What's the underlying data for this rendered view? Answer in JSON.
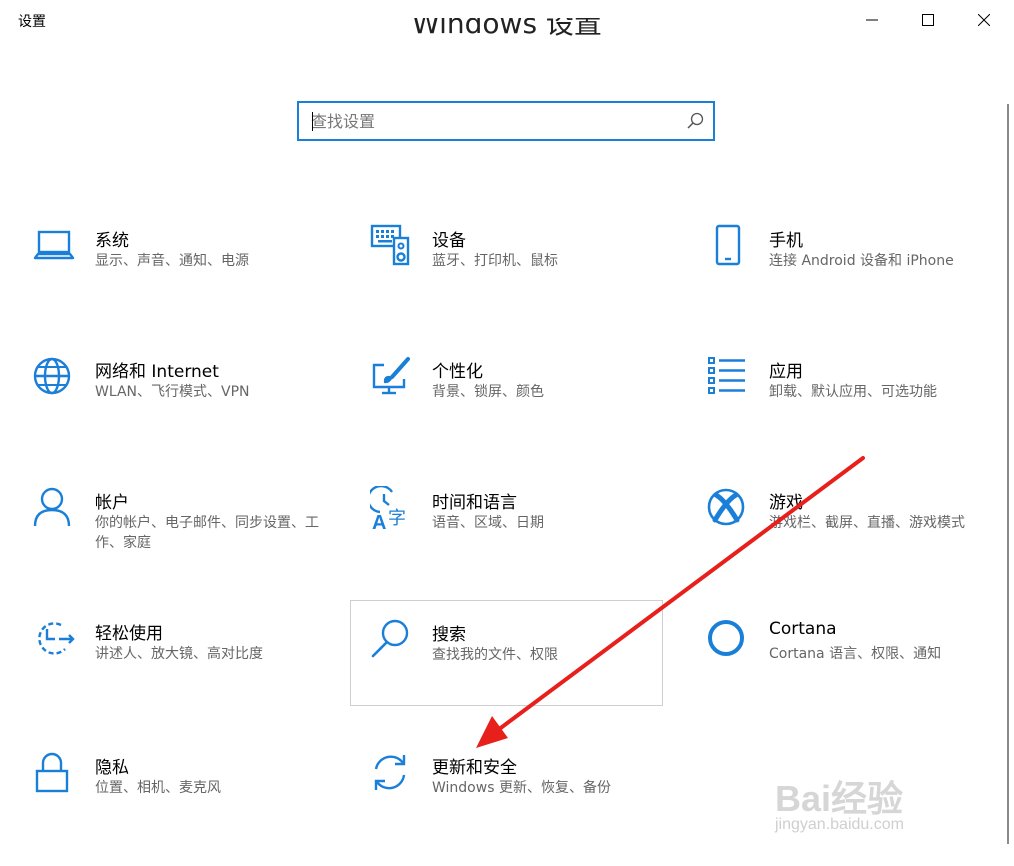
{
  "window": {
    "title": "设置",
    "minimize_icon": "minimize-icon",
    "maximize_icon": "maximize-icon",
    "close_icon": "close-icon"
  },
  "heading": "Windows 设置",
  "search": {
    "placeholder": "查找设置",
    "icon": "search-icon"
  },
  "tiles": [
    {
      "id": "system",
      "name": "系统",
      "desc": "显示、声音、通知、电源",
      "icon": "laptop-icon"
    },
    {
      "id": "devices",
      "name": "设备",
      "desc": "蓝牙、打印机、鼠标",
      "icon": "keyboard-speaker-icon"
    },
    {
      "id": "phone",
      "name": "手机",
      "desc": "连接 Android 设备和 iPhone",
      "icon": "phone-icon"
    },
    {
      "id": "network",
      "name": "网络和 Internet",
      "desc": "WLAN、飞行模式、VPN",
      "icon": "globe-icon"
    },
    {
      "id": "personalization",
      "name": "个性化",
      "desc": "背景、锁屏、颜色",
      "icon": "paint-brush-icon"
    },
    {
      "id": "apps",
      "name": "应用",
      "desc": "卸载、默认应用、可选功能",
      "icon": "list-icon"
    },
    {
      "id": "accounts",
      "name": "帐户",
      "desc": "你的帐户、电子邮件、同步设置、工作、家庭",
      "icon": "person-icon"
    },
    {
      "id": "time",
      "name": "时间和语言",
      "desc": "语音、区域、日期",
      "icon": "clock-language-icon"
    },
    {
      "id": "gaming",
      "name": "游戏",
      "desc": "游戏栏、截屏、直播、游戏模式",
      "icon": "xbox-icon"
    },
    {
      "id": "ease",
      "name": "轻松使用",
      "desc": "讲述人、放大镜、高对比度",
      "icon": "ease-of-access-icon"
    },
    {
      "id": "search",
      "name": "搜索",
      "desc": "查找我的文件、权限",
      "icon": "magnifier-icon"
    },
    {
      "id": "cortana",
      "name": "Cortana",
      "desc": "Cortana 语言、权限、通知",
      "icon": "cortana-ring-icon"
    },
    {
      "id": "privacy",
      "name": "隐私",
      "desc": "位置、相机、麦克风",
      "icon": "lock-icon"
    },
    {
      "id": "update",
      "name": "更新和安全",
      "desc": "Windows 更新、恢复、备份",
      "icon": "sync-icon"
    }
  ],
  "watermark": {
    "logo": "Bai经验",
    "url": "jingyan.baidu.com"
  },
  "colors": {
    "accent": "#1a7fd8",
    "arrow": "#e8201b"
  }
}
